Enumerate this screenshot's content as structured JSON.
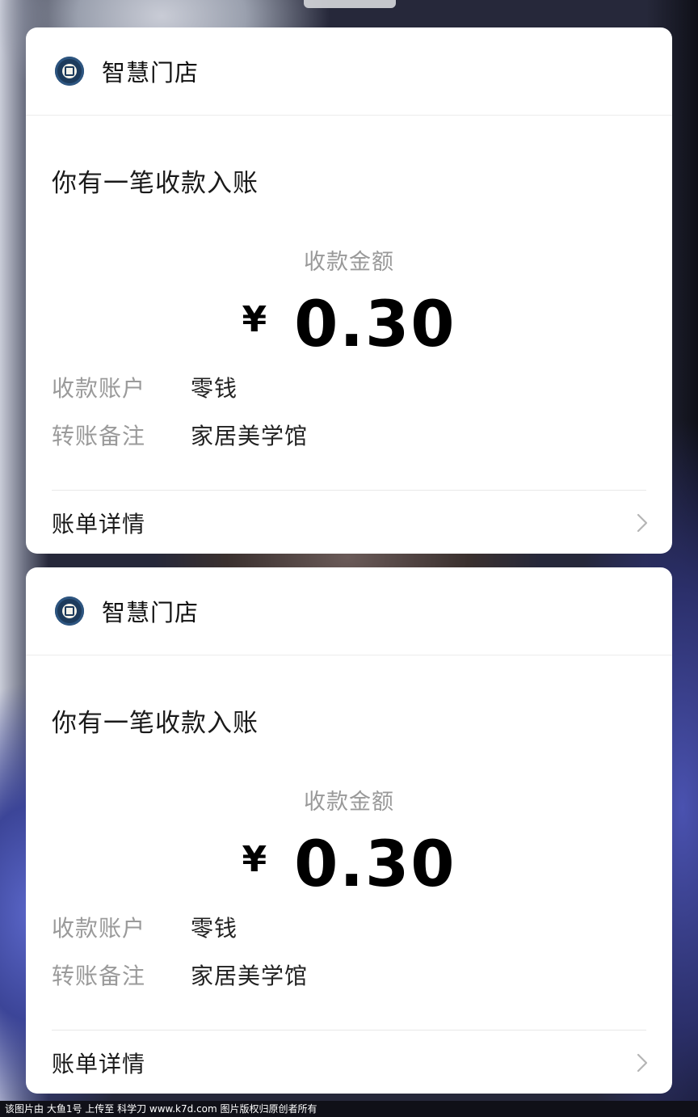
{
  "cards": [
    {
      "merchant": "智慧门店",
      "title": "你有一笔收款入账",
      "amount_label": "收款金额",
      "currency": "¥",
      "amount": "0.30",
      "account_label": "收款账户",
      "account_value": "零钱",
      "note_label": "转账备注",
      "note_value": "家居美学馆",
      "detail_label": "账单详情"
    },
    {
      "merchant": "智慧门店",
      "title": "你有一笔收款入账",
      "amount_label": "收款金额",
      "currency": "¥",
      "amount": "0.30",
      "account_label": "收款账户",
      "account_value": "零钱",
      "note_label": "转账备注",
      "note_value": "家居美学馆",
      "detail_label": "账单详情"
    }
  ],
  "footer_text": "该图片由 大鱼1号 上传至 科学刀 www.k7d.com 图片版权归原创者所有",
  "icons": {
    "merchant_logo": "store-logo-icon",
    "detail_arrow": "chevron-right-icon"
  },
  "colors": {
    "card_bg": "#ffffff",
    "muted_text": "#999999",
    "primary_text": "#111111"
  }
}
